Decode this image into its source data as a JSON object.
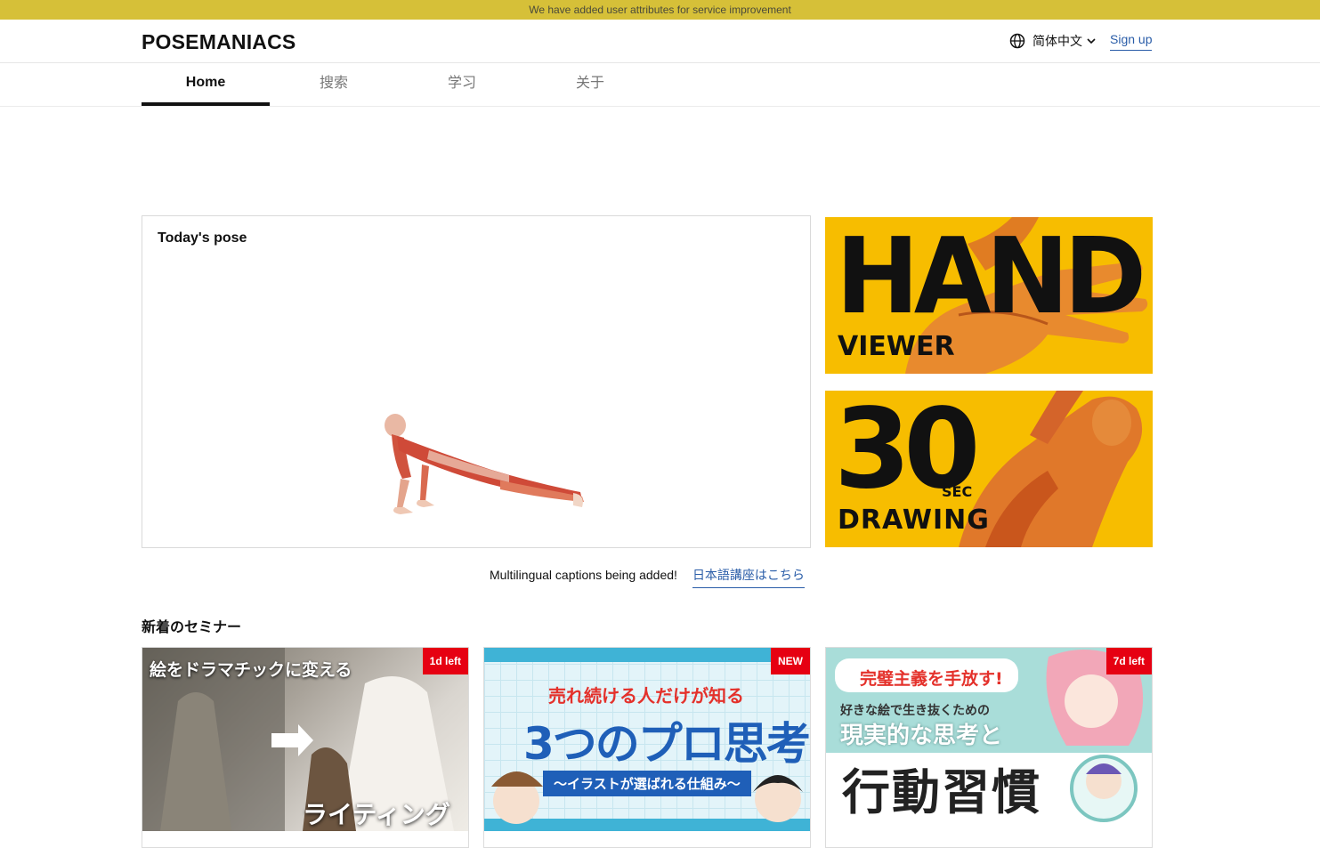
{
  "notice": {
    "text": "We have added user attributes for service improvement"
  },
  "header": {
    "logo": "POSEMANIACS",
    "language": "简体中文",
    "signup": "Sign up"
  },
  "tabs": [
    {
      "label": "Home",
      "active": true
    },
    {
      "label": "搜索",
      "active": false
    },
    {
      "label": "学习",
      "active": false
    },
    {
      "label": "关于",
      "active": false
    }
  ],
  "pose": {
    "title": "Today's pose"
  },
  "banners": {
    "hand": {
      "big": "HAND",
      "small": "VIEWER"
    },
    "thirty": {
      "big": "30",
      "unit": "SEC",
      "small": "DRAWING"
    }
  },
  "captions": {
    "text": "Multilingual captions being added!",
    "link": "日本語講座はこちら"
  },
  "seminars": {
    "title": "新着のセミナー",
    "items": [
      {
        "badge": "1d left",
        "headline": "絵をドラマチックに変える",
        "sub": "ライティング"
      },
      {
        "badge": "NEW",
        "headline": "売れ続ける人だけが知る",
        "big": "3つのプロ思考",
        "sub": "〜イラストが選ばれる仕組み〜"
      },
      {
        "badge": "7d left",
        "headline": "完璧主義を手放す!",
        "line2": "好きな絵で生き抜くための",
        "line3": "現実的な思考と",
        "big": "行動習慣"
      }
    ]
  },
  "colors": {
    "notice_bg": "#d6c038",
    "banner_yellow": "#f7bd00",
    "link_blue": "#2a5da8",
    "badge_red": "#e60012"
  }
}
